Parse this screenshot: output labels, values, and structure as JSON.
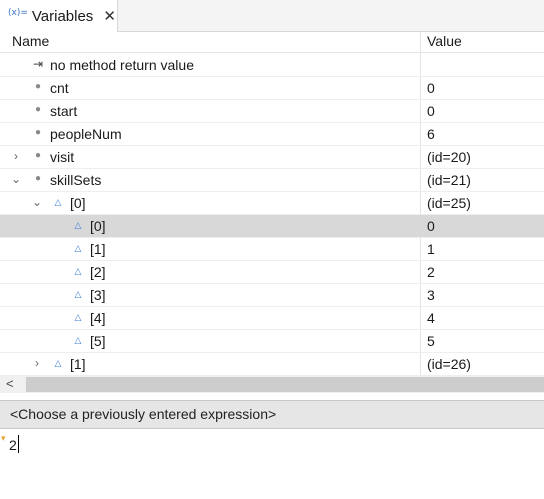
{
  "tab": {
    "icon": "(x)=",
    "title": "Variables",
    "close": "✕"
  },
  "header": {
    "name": "Name",
    "value": "Value"
  },
  "rows": [
    {
      "name": "no method return value",
      "value": "",
      "icon": "return-icon",
      "twisty": ""
    },
    {
      "name": "cnt",
      "value": "0",
      "icon": "field-icon",
      "twisty": ""
    },
    {
      "name": "start",
      "value": "0",
      "icon": "field-icon",
      "twisty": ""
    },
    {
      "name": "peopleNum",
      "value": "6",
      "icon": "field-icon",
      "twisty": ""
    },
    {
      "name": "visit",
      "value": "(id=20)",
      "icon": "field-icon",
      "twisty": "collapsed"
    },
    {
      "name": "skillSets",
      "value": "(id=21)",
      "icon": "field-icon",
      "twisty": "expanded"
    },
    {
      "name": "[0]",
      "value": "(id=25)",
      "icon": "array-element-icon",
      "twisty": "expanded"
    },
    {
      "name": "[0]",
      "value": "0",
      "icon": "array-element-icon",
      "twisty": "",
      "selected": true
    },
    {
      "name": "[1]",
      "value": "1",
      "icon": "array-element-icon",
      "twisty": ""
    },
    {
      "name": "[2]",
      "value": "2",
      "icon": "array-element-icon",
      "twisty": ""
    },
    {
      "name": "[3]",
      "value": "3",
      "icon": "array-element-icon",
      "twisty": ""
    },
    {
      "name": "[4]",
      "value": "4",
      "icon": "array-element-icon",
      "twisty": ""
    },
    {
      "name": "[5]",
      "value": "5",
      "icon": "array-element-icon",
      "twisty": ""
    },
    {
      "name": "[1]",
      "value": "(id=26)",
      "icon": "array-element-icon",
      "twisty": "collapsed"
    }
  ],
  "scroll": {
    "left_arrow": "<"
  },
  "expression": {
    "placeholder": "<Choose a previously entered expression>"
  },
  "detail": {
    "text": "2"
  },
  "colors": {
    "selected_row": "#d8d8d8",
    "array_icon": "#3b7dd8",
    "field_icon": "#888888"
  }
}
